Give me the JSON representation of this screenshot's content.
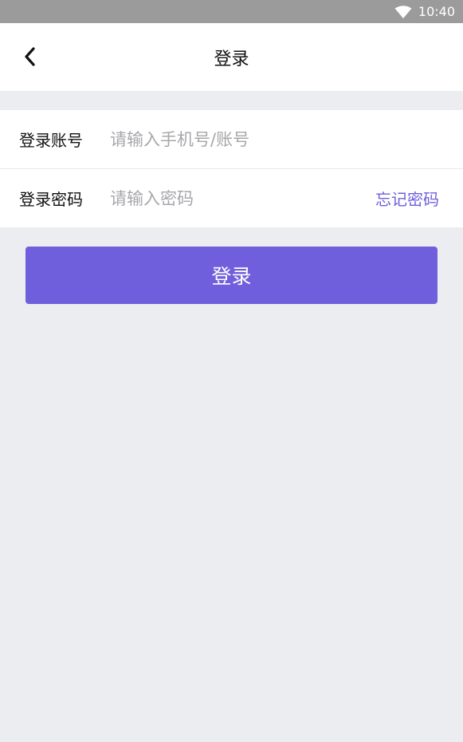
{
  "status_bar": {
    "time": "10:40",
    "wifi_icon": "wifi-icon"
  },
  "header": {
    "back_icon": "chevron-left-icon",
    "title": "登录"
  },
  "form": {
    "account": {
      "label": "登录账号",
      "value": "",
      "placeholder": "请输入手机号/账号"
    },
    "password": {
      "label": "登录密码",
      "value": "",
      "placeholder": "请输入密码",
      "forgot_label": "忘记密码"
    }
  },
  "login_button": {
    "label": "登录"
  },
  "colors": {
    "accent": "#6f5fdc",
    "status_bar": "#9b9b9b",
    "background": "#ecedf0",
    "placeholder": "#a7a7ab"
  }
}
